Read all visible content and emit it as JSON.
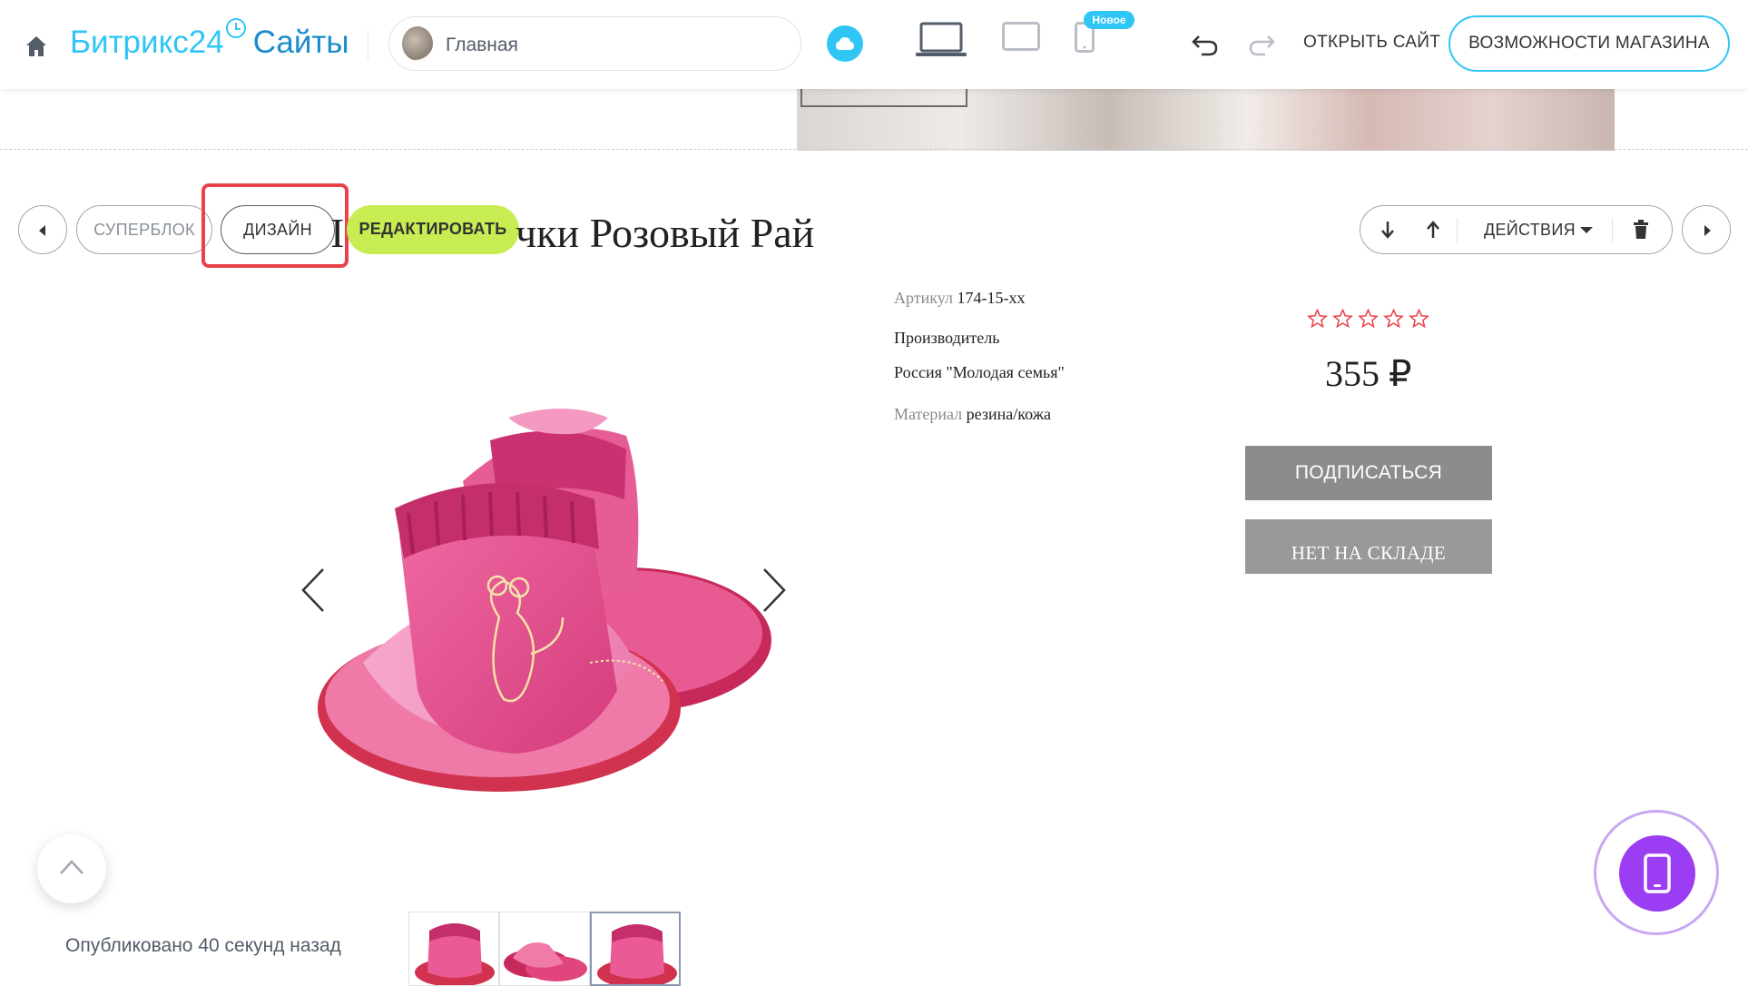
{
  "topbar": {
    "logo_main": "Битрикс24",
    "logo_sites": "Сайты",
    "page_select_label": "Главная",
    "new_badge": "Новое",
    "open_site": "ОТКРЫТЬ САЙТ",
    "shop_features": "ВОЗМОЖНОСТИ МАГАЗИНА"
  },
  "block_toolbar": {
    "superblock": "СУПЕРБЛОК",
    "design": "ДИЗАЙН",
    "edit": "РЕДАКТИРОВАТЬ",
    "actions": "ДЕЙСТВИЯ"
  },
  "product": {
    "title_visible": "чки Розовый Рай",
    "title_prefix_visible": "I",
    "sku_label": "Артикул",
    "sku_value": "174-15-xx",
    "maker_label": "Производитель",
    "maker_value": "Россия \"Молодая семья\"",
    "material_label": "Материал",
    "material_value": "резина/кожа",
    "rating": 0,
    "rating_max": 5,
    "price": "355 ₽",
    "subscribe": "ПОДПИСАТЬСЯ",
    "out_of_stock": "НЕТ НА СКЛАДЕ"
  },
  "footer": {
    "published": "Опубликовано 40 секунд назад"
  },
  "colors": {
    "accent": "#2fc6f6",
    "edit_button": "#c7ed53",
    "highlight": "#e8424b",
    "mobile_fab": "#9b3df2",
    "star_outline": "#e8424b"
  },
  "icons": [
    "home-icon",
    "cloud-icon",
    "desktop-icon",
    "tablet-icon",
    "mobile-icon",
    "undo-icon",
    "redo-icon",
    "arrow-down-icon",
    "arrow-up-icon",
    "chevron-down-icon",
    "trash-icon",
    "chevron-left-icon",
    "chevron-right-icon",
    "star-icon",
    "chevron-up-icon",
    "phone-icon"
  ]
}
